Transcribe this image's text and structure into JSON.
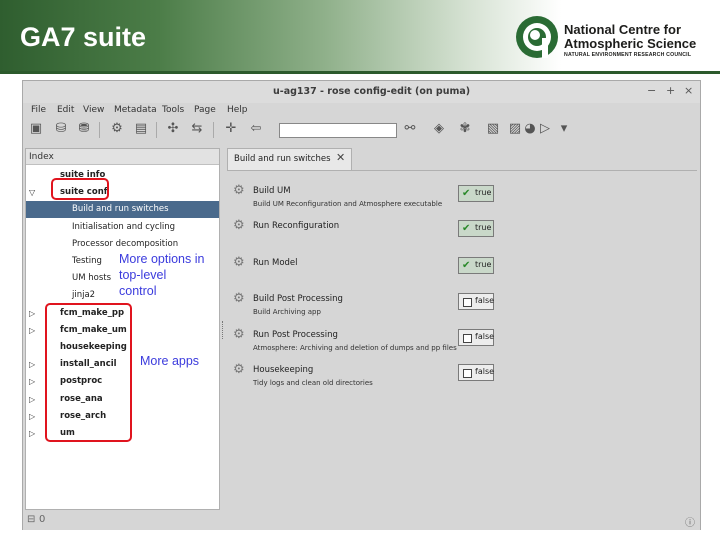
{
  "slide": {
    "title": "GA7 suite",
    "logo": {
      "line1": "National Centre for",
      "line2": "Atmospheric Science",
      "line3": "NATURAL ENVIRONMENT RESEARCH COUNCIL"
    },
    "header_color": "#2f5e2f"
  },
  "window": {
    "title": "u-ag137 - rose config-edit (on puma)",
    "controls": [
      "−",
      "+",
      "×"
    ]
  },
  "menubar": {
    "items": [
      "File",
      "Edit",
      "View",
      "Metadata",
      "Tools",
      "Page",
      "Help"
    ]
  },
  "toolbar": {
    "icons": [
      "open-icon",
      "undo-icon",
      "redo-icon",
      "find-icon",
      "page-icon",
      "add-icon",
      "remove-icon",
      "pin-icon",
      "warning-icon",
      "search-icon",
      "navigate-icon",
      "settings-icon",
      "folder-icon",
      "color-icon",
      "run-icon",
      "dropdown-icon"
    ],
    "search_value": ""
  },
  "index": {
    "header": "Index",
    "items": [
      {
        "label": "suite info",
        "arrow": "",
        "bold": true
      },
      {
        "label": "suite conf",
        "arrow": "▽",
        "bold": true
      },
      {
        "label": "Build and run switches",
        "arrow": "",
        "bold": false,
        "selected": true
      },
      {
        "label": "Initialisation and cycling",
        "arrow": "",
        "bold": false
      },
      {
        "label": "Processor decomposition",
        "arrow": "",
        "bold": false
      },
      {
        "label": "Testing",
        "arrow": "",
        "bold": false
      },
      {
        "label": "UM hosts",
        "arrow": "",
        "bold": false
      },
      {
        "label": "jinja2",
        "arrow": "",
        "bold": false
      },
      {
        "label": "fcm_make_pp",
        "arrow": "▷",
        "bold": true
      },
      {
        "label": "fcm_make_um",
        "arrow": "▷",
        "bold": true
      },
      {
        "label": "housekeeping",
        "arrow": "",
        "bold": true
      },
      {
        "label": "install_ancil",
        "arrow": "▷",
        "bold": true
      },
      {
        "label": "postproc",
        "arrow": "▷",
        "bold": true
      },
      {
        "label": "rose_ana",
        "arrow": "▷",
        "bold": true
      },
      {
        "label": "rose_arch",
        "arrow": "▷",
        "bold": true
      },
      {
        "label": "um",
        "arrow": "▷",
        "bold": true
      }
    ]
  },
  "tab": {
    "label": "Build and run switches",
    "close": "✕"
  },
  "settings": [
    {
      "label": "Build UM",
      "desc": "Build UM Reconfiguration and Atmosphere executable",
      "value": "true",
      "on": true
    },
    {
      "label": "Run Reconfiguration",
      "desc": "",
      "value": "true",
      "on": true
    },
    {
      "label": "Run Model",
      "desc": "",
      "value": "true",
      "on": true
    },
    {
      "label": "Build Post Processing",
      "desc": "Build Archiving app",
      "value": "false",
      "on": false
    },
    {
      "label": "Run Post Processing",
      "desc": "Atmosphere: Archiving and deletion of dumps and pp files",
      "value": "false",
      "on": false
    },
    {
      "label": "Housekeeping",
      "desc": "Tidy logs and clean old directories",
      "value": "false",
      "on": false
    }
  ],
  "annotations": {
    "top_level": [
      "More options in",
      "top-level",
      "control"
    ],
    "apps": "More apps"
  },
  "highlight_color": "#e0141e",
  "annotation_color": "#3b3bdd"
}
